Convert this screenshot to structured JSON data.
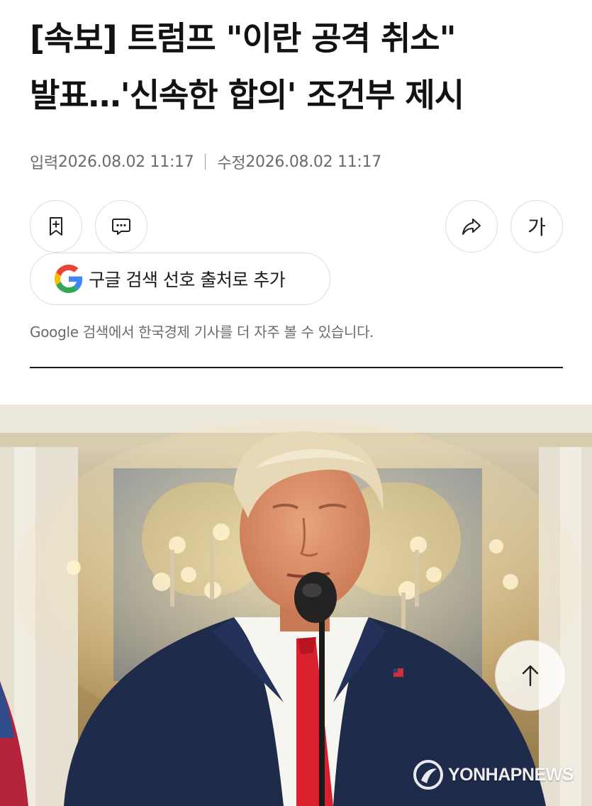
{
  "article": {
    "headline_line1": "[속보] 트럼프 \"이란 공격 취소\"",
    "headline_line2": "발표…'신속한 합의' 조건부 제시",
    "input_label": "입력",
    "input_time": "2026.08.02 11:17",
    "modified_label": "수정",
    "modified_time": "2026.08.02 11:17"
  },
  "actions": {
    "bookmark_icon": "bookmark-plus-icon",
    "comment_icon": "comment-icon",
    "share_icon": "share-icon",
    "font_size_label": "가"
  },
  "google": {
    "button_label": "구글 검색 선호 출처로 추가",
    "note": "Google 검색에서 한국경제 기사를 더 자주 볼 수 있습니다.",
    "brand_colors": [
      "#4285F4",
      "#EA4335",
      "#FBBC05",
      "#34A853"
    ]
  },
  "photo": {
    "watermark": "YONHAPNEWS"
  },
  "scroll_top": {
    "icon": "arrow-up-icon"
  }
}
